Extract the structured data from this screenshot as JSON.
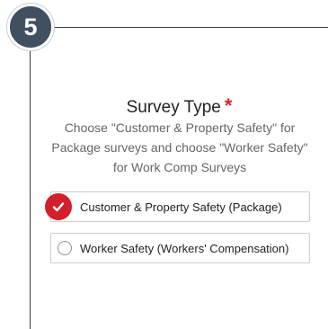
{
  "step": {
    "number": "5"
  },
  "question": {
    "title": "Survey Type",
    "required_mark": "*",
    "description": "Choose \"Customer & Property Safety\" for Package surveys and choose \"Worker Safety\" for Work Comp Surveys"
  },
  "options": [
    {
      "label": "Customer & Property Safety (Package)",
      "selected": true
    },
    {
      "label": "Worker Safety (Workers' Compensation)",
      "selected": false
    }
  ],
  "colors": {
    "badge": "#405060",
    "required": "#d8232a",
    "selected_check": "#d21f2b"
  },
  "icons": {
    "selected": "check-icon",
    "unselected": "radio-icon"
  }
}
